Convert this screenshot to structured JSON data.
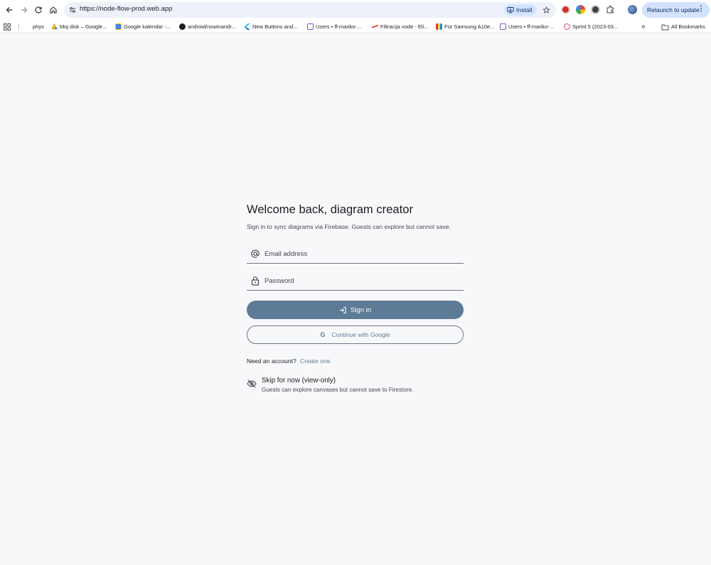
{
  "browser": {
    "url": "https://node-flow-prod.web.app",
    "install_label": "Install",
    "relaunch_label": "Relaunch to update",
    "bookmarks": [
      {
        "label": "phys",
        "icon": "none"
      },
      {
        "label": "Moj disk – Google...",
        "icon": "google-drive-icon"
      },
      {
        "label": "Google kalendar -...",
        "icon": "google-calendar-icon"
      },
      {
        "label": "android/nowinandr...",
        "icon": "github-icon"
      },
      {
        "label": "New Buttons and...",
        "icon": "flutter-icon"
      },
      {
        "label": "Users • ff-mariko-...",
        "icon": "firebase-icon"
      },
      {
        "label": "Filtracija vode - Eli...",
        "icon": "site-icon"
      },
      {
        "label": "Für Samsung A10e...",
        "icon": "shop-icon"
      },
      {
        "label": "Users • ff-mariko-...",
        "icon": "firebase-icon"
      },
      {
        "label": "Sprint 5 (2023-03...",
        "icon": "jira-icon"
      }
    ],
    "all_bookmarks_label": "All Bookmarks"
  },
  "login": {
    "title": "Welcome back, diagram creator",
    "subtitle": "Sign in to sync diagrams via Firebase. Guests can explore but cannot save.",
    "email_placeholder": "Email address",
    "password_placeholder": "Password",
    "signin_label": "Sign in",
    "google_label": "Continue with Google",
    "google_glyph": "G",
    "need_account": "Need an account?",
    "create_link": "Create one",
    "skip_title": "Skip for now (view-only)",
    "skip_desc": "Guests can explore canvases but cannot save to Firestore."
  },
  "colors": {
    "accent": "#5d7b96",
    "background": "#f7f8fa",
    "omnibox": "#edf2fa",
    "chip": "#d3e3fd"
  }
}
